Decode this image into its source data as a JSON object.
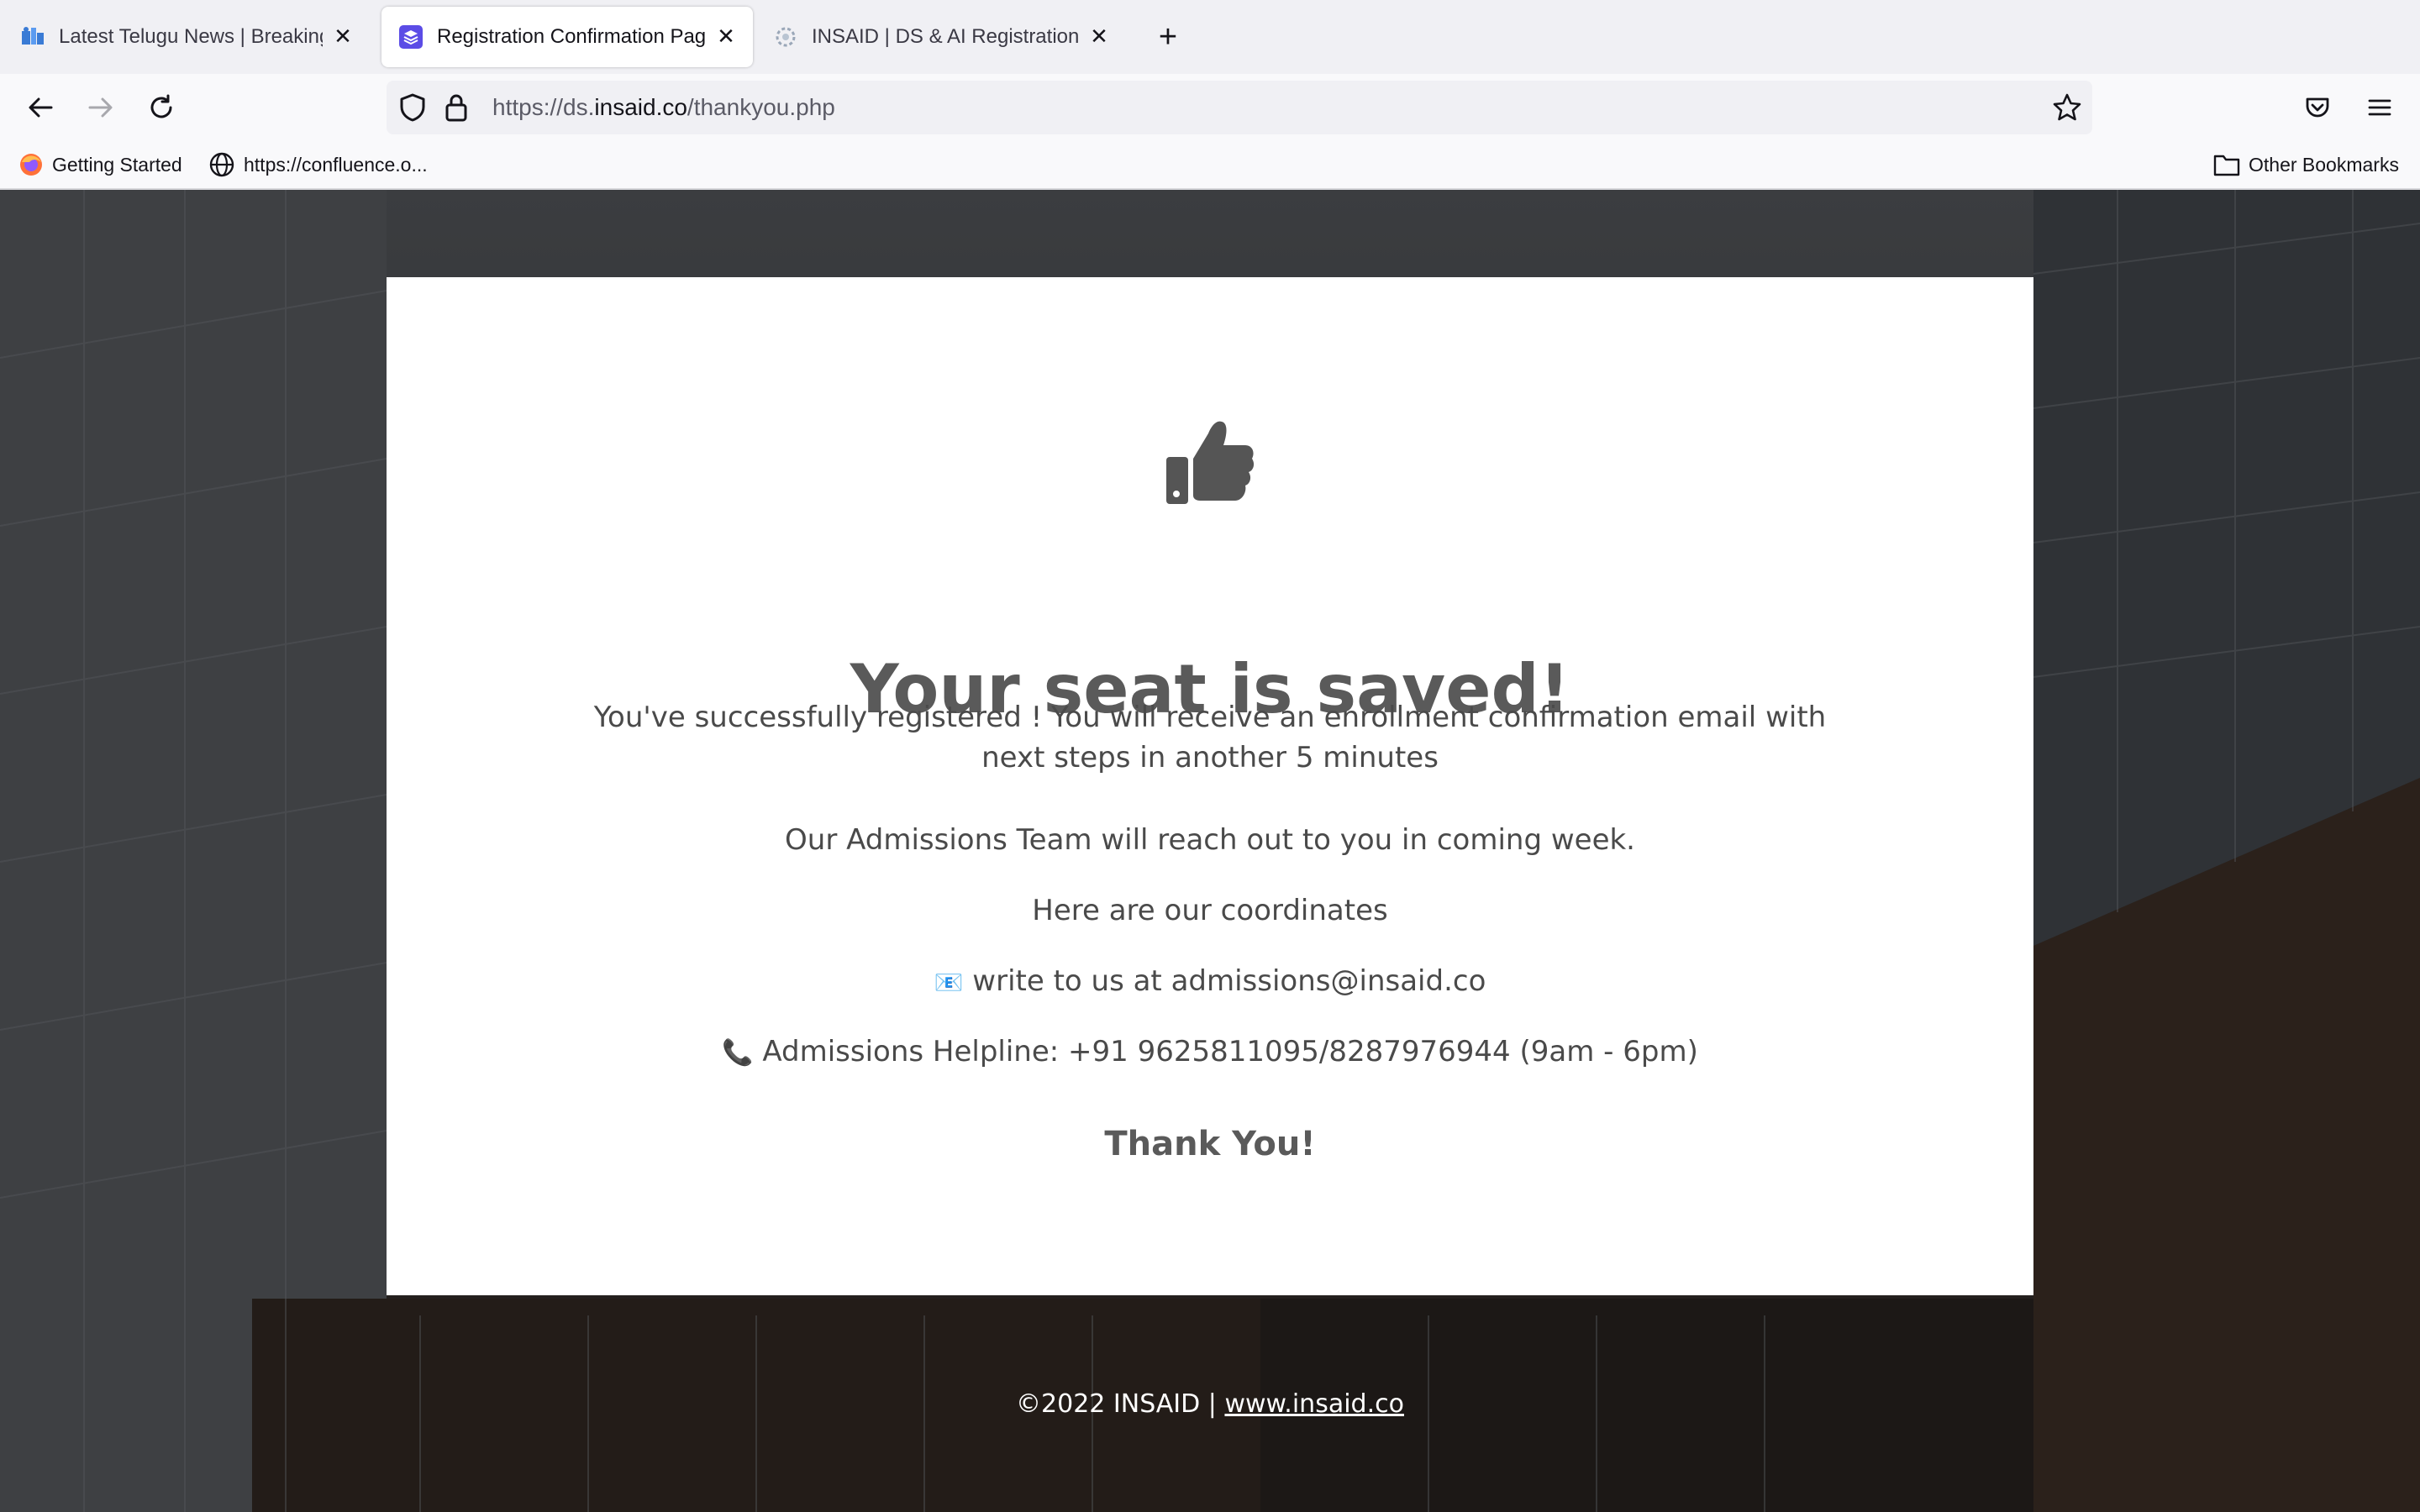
{
  "browser": {
    "tabs": [
      {
        "title": "Latest Telugu News | Breaking N",
        "favicon": "news-favicon-icon",
        "active": false
      },
      {
        "title": "Registration Confirmation Page",
        "favicon": "insaid-favicon-icon",
        "active": true
      },
      {
        "title": "INSAID | DS & AI Registration",
        "favicon": "loading-favicon-icon",
        "active": false
      }
    ],
    "url": {
      "prefix": "https://ds.",
      "host": "insaid.co",
      "path": "/thankyou.php"
    },
    "bookmarks": [
      {
        "label": "Getting Started",
        "icon": "firefox-icon"
      },
      {
        "label": "https://confluence.o...",
        "icon": "globe-icon"
      }
    ],
    "other_bookmarks": "Other Bookmarks"
  },
  "page": {
    "headline": "Your seat is saved!",
    "message_line1": "You've successfully registered  ! You will receive an enrollment confirmation email with",
    "message_line2": "next steps in another 5 minutes",
    "team_line": "Our Admissions Team will reach out to you in coming week.",
    "coordinates_line": "Here are our coordinates",
    "email_emoji": "📧",
    "email_line": "write to us at admissions@insaid.co",
    "phone_emoji": "📞",
    "phone_line": "Admissions Helpline: +91 9625811095/8287976944 (9am - 6pm)",
    "thanks": "Thank You!",
    "footer_text": "©2022 INSAID | ",
    "footer_link": "www.insaid.co"
  },
  "colors": {
    "accent": "#5b4ce6",
    "text": "#555555",
    "card": "#ffffff"
  }
}
